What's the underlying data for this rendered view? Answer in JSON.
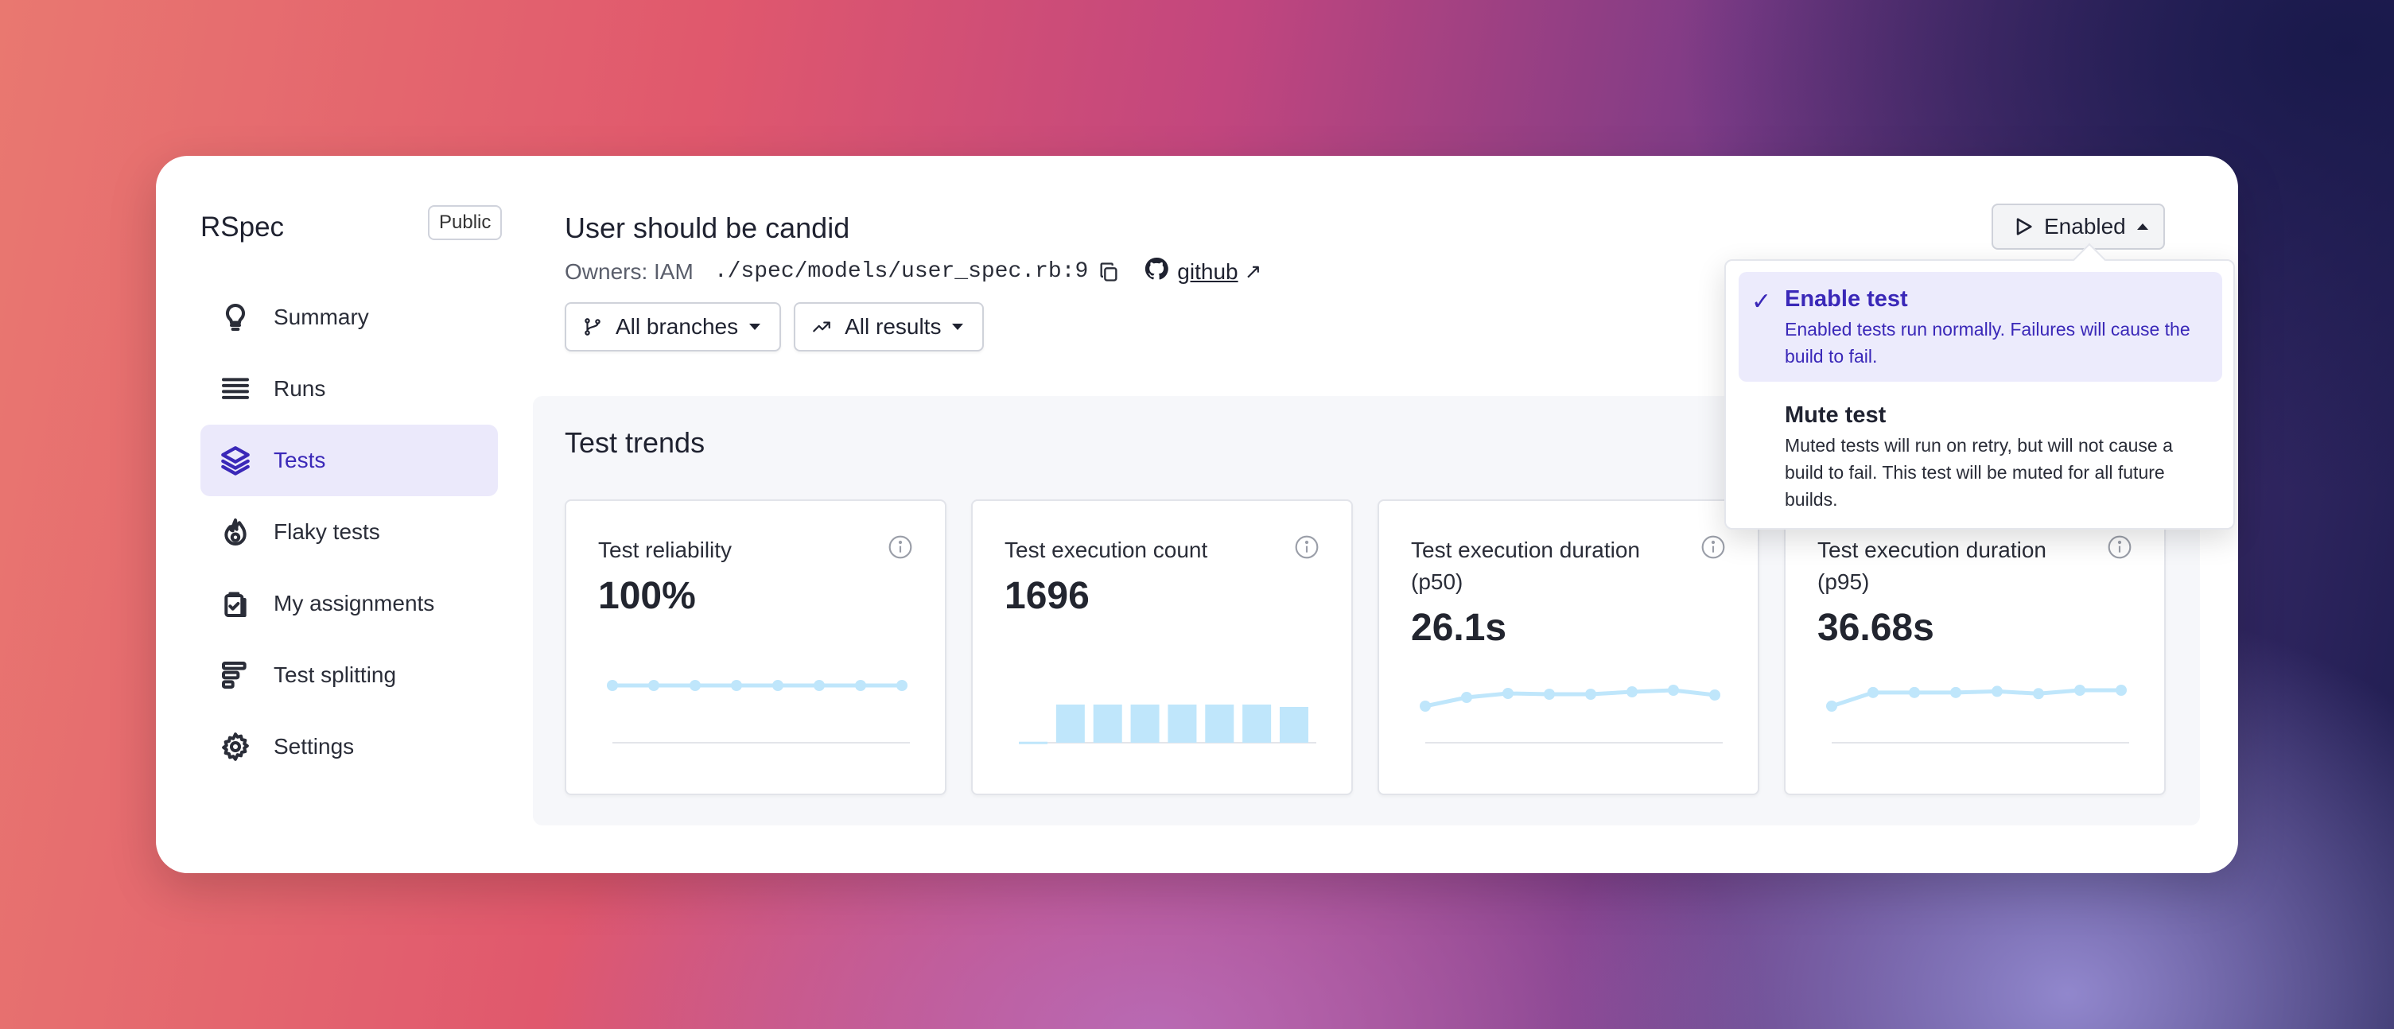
{
  "sidebar": {
    "app_name": "RSpec",
    "visibility_badge": "Public",
    "items": [
      {
        "label": "Summary",
        "icon": "lightbulb-icon"
      },
      {
        "label": "Runs",
        "icon": "list-icon"
      },
      {
        "label": "Tests",
        "icon": "layers-icon",
        "active": true
      },
      {
        "label": "Flaky tests",
        "icon": "flame-icon"
      },
      {
        "label": "My assignments",
        "icon": "clipboard-check-icon"
      },
      {
        "label": "Test splitting",
        "icon": "split-bars-icon"
      },
      {
        "label": "Settings",
        "icon": "gear-icon"
      }
    ]
  },
  "header": {
    "title": "User should be candid",
    "owners": "Owners: IAM",
    "path": "./spec/models/user_spec.rb:9",
    "github_link": "github",
    "state_button": "Enabled"
  },
  "filters": {
    "branches": "All branches",
    "results": "All results"
  },
  "trends": {
    "title": "Test trends",
    "metrics": [
      {
        "label": "Test reliability",
        "value": "100%",
        "chart": "line",
        "points": [
          100,
          100,
          100,
          100,
          100,
          100,
          100,
          100
        ]
      },
      {
        "label": "Test execution count",
        "value": "1696",
        "chart": "bar",
        "points": [
          6,
          228,
          228,
          228,
          228,
          228,
          228,
          214
        ]
      },
      {
        "label": "Test execution duration (p50)",
        "value": "26.1s",
        "chart": "line",
        "points": [
          24.5,
          25.6,
          26.1,
          26.0,
          26.0,
          26.3,
          26.5,
          25.9
        ]
      },
      {
        "label": "Test execution duration (p95)",
        "value": "36.68s",
        "chart": "line",
        "points": [
          35.4,
          36.6,
          36.6,
          36.6,
          36.7,
          36.5,
          36.8,
          36.8
        ]
      }
    ]
  },
  "dropdown": {
    "options": [
      {
        "name": "Enable test",
        "description": "Enabled tests run normally. Failures will cause the build to fail.",
        "selected": true
      },
      {
        "name": "Mute test",
        "description": "Muted tests will run on retry, but will not cause a build to fail. This test will be muted for all future builds.",
        "selected": false
      }
    ]
  },
  "colors": {
    "accent": "#3a28b8",
    "active_bg": "#ebe9fb",
    "chart": "#bfe6fb"
  }
}
